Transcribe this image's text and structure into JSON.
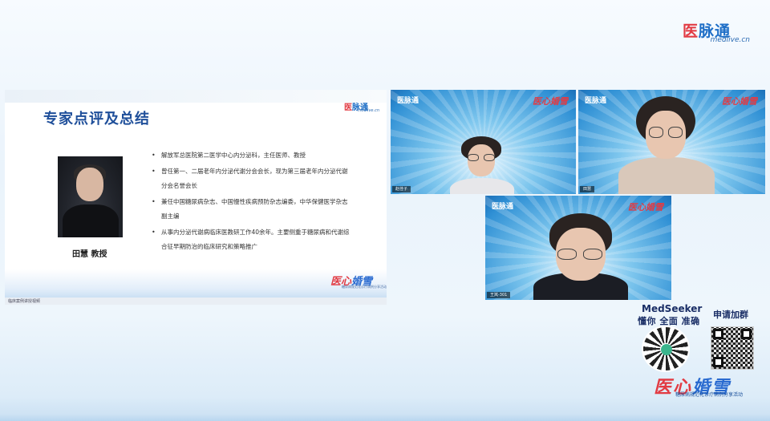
{
  "brand": {
    "name_first": "医",
    "name_rest": "脉通",
    "url": "medlive.cn"
  },
  "slide": {
    "title": "专家点评及总结",
    "logo_first": "医",
    "logo_rest": "脉通",
    "logo_url": "medlive.cn",
    "caption": "田慧  教授",
    "bullets": [
      "解放军总医院第二医学中心内分泌科，主任医师、教授",
      "曾任第一、二届老年内分泌代谢分会会长，现为第三届老年内分泌代谢分会名誉会长",
      "兼任中国糖尿病杂志、中国慢性疾病预防杂志编委，中华保健医学杂志副主编",
      "从事内分泌代谢病临床医教研工作40余年。主要侧重于糖尿病和代谢综合征早期防治的临床研究和策略推广"
    ],
    "footer_logo_first": "医心",
    "footer_logo_rest": "婚雪",
    "footer_sub": "糖尿病规范化诊疗病例分享活动",
    "status_text": "临床案例讲授视频"
  },
  "tiles": [
    {
      "logo": "医脉通",
      "logo2": "医心婚雪",
      "label": "赵佳子"
    },
    {
      "logo": "医脉通",
      "logo2": "医心婚雪",
      "label": "田慧"
    },
    {
      "logo": "医脉通",
      "logo2": "医心婚雪",
      "label": "王岚-301"
    }
  ],
  "promo": {
    "medseeker": "MedSeeker",
    "medseeker_sub": "懂你 全面 准确",
    "join": "申请加群",
    "logo_first": "医心",
    "logo_rest": "婚雪",
    "sub": "糖尿病规范化诊疗病例分享活动"
  },
  "colors": {
    "accent_blue": "#1f6fc7",
    "accent_red": "#e23b43",
    "title_navy": "#1f4f9a"
  }
}
